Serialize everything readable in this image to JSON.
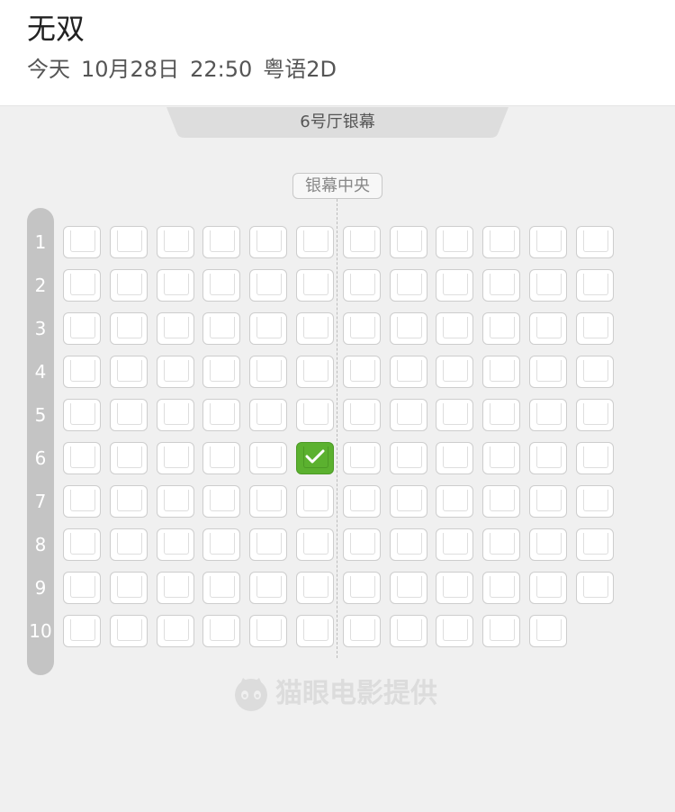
{
  "header": {
    "title": "无双",
    "day": "今天",
    "date": "10月28日",
    "time": "22:50",
    "format": "粤语2D"
  },
  "hall": {
    "screen_label": "6号厅银幕",
    "center_label": "银幕中央"
  },
  "rows": [
    {
      "label": "1",
      "seats": 12
    },
    {
      "label": "2",
      "seats": 12
    },
    {
      "label": "3",
      "seats": 12
    },
    {
      "label": "4",
      "seats": 12
    },
    {
      "label": "5",
      "seats": 12
    },
    {
      "label": "6",
      "seats": 12
    },
    {
      "label": "7",
      "seats": 12
    },
    {
      "label": "8",
      "seats": 12
    },
    {
      "label": "9",
      "seats": 12
    },
    {
      "label": "10",
      "seats": 11
    }
  ],
  "selected_seats": [
    {
      "row": 6,
      "seat": 6
    }
  ],
  "watermark": {
    "text": "猫眼电影提供",
    "logo_icon": "maoyan-cat-icon"
  },
  "colors": {
    "selected": "#5bb12f",
    "available": "#ffffff",
    "row_bar": "#c4c4c4"
  }
}
